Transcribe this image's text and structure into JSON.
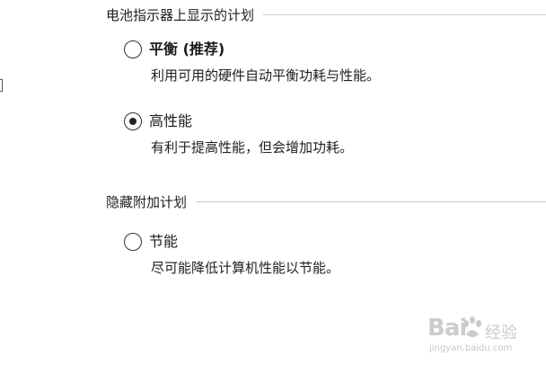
{
  "sections": [
    {
      "title": "电池指示器上显示的计划",
      "options": [
        {
          "label": "平衡 (推荐)",
          "description": "利用可用的硬件自动平衡功耗与性能。",
          "checked": false
        },
        {
          "label": "高性能",
          "description": "有利于提高性能，但会增加功耗。",
          "checked": true
        }
      ]
    },
    {
      "title": "隐藏附加计划",
      "options": [
        {
          "label": "节能",
          "description": "尽可能降低计算机性能以节能。",
          "checked": false
        }
      ]
    }
  ],
  "watermark": {
    "brand": "Bai",
    "brand_suffix": "经验",
    "url": "jingyan.baidu.com"
  }
}
